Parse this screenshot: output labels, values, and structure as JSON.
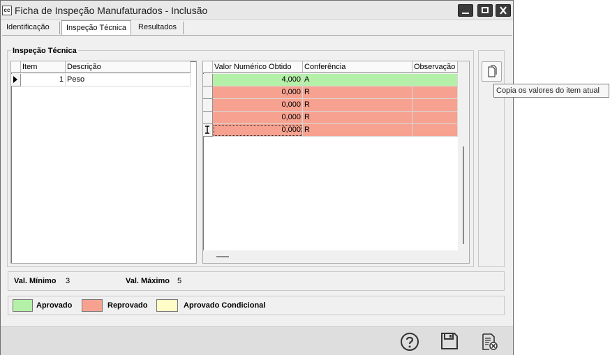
{
  "window": {
    "icon_text": "cc",
    "title": "Ficha de Inspeção Manufaturados - Inclusão"
  },
  "tabs": [
    {
      "label": "Identificação"
    },
    {
      "label": "Inspeção Técnica"
    },
    {
      "label": "Resultados"
    }
  ],
  "group_title": "Inspeção Técnica",
  "items_grid": {
    "headers": [
      "Item",
      "Descrição"
    ],
    "rows": [
      {
        "item": "1",
        "descricao": "Peso"
      }
    ]
  },
  "values_grid": {
    "headers": [
      "Valor Numérico Obtido",
      "Conferência",
      "Observação"
    ],
    "rows": [
      {
        "valor": "4,000",
        "conferencia": "A",
        "observacao": ""
      },
      {
        "valor": "0,000",
        "conferencia": "R",
        "observacao": ""
      },
      {
        "valor": "0,000",
        "conferencia": "R",
        "observacao": ""
      },
      {
        "valor": "0,000",
        "conferencia": "R",
        "observacao": ""
      },
      {
        "valor": "0,000",
        "conferencia": "R",
        "observacao": ""
      }
    ]
  },
  "tooltip": "Copia os valores do item atual",
  "limits": {
    "min_label": "Val. Mínimo",
    "min_value": "3",
    "max_label": "Val. Máximo",
    "max_value": "5"
  },
  "legend": [
    {
      "label": "Aprovado",
      "color": "#b4f0a8"
    },
    {
      "label": "Reprovado",
      "color": "#f7a290"
    },
    {
      "label": "Aprovado Condicional",
      "color": "#fffdc8"
    }
  ],
  "colors": {
    "approved_row": "#b4f0a8",
    "rejected_row": "#f7a290"
  }
}
